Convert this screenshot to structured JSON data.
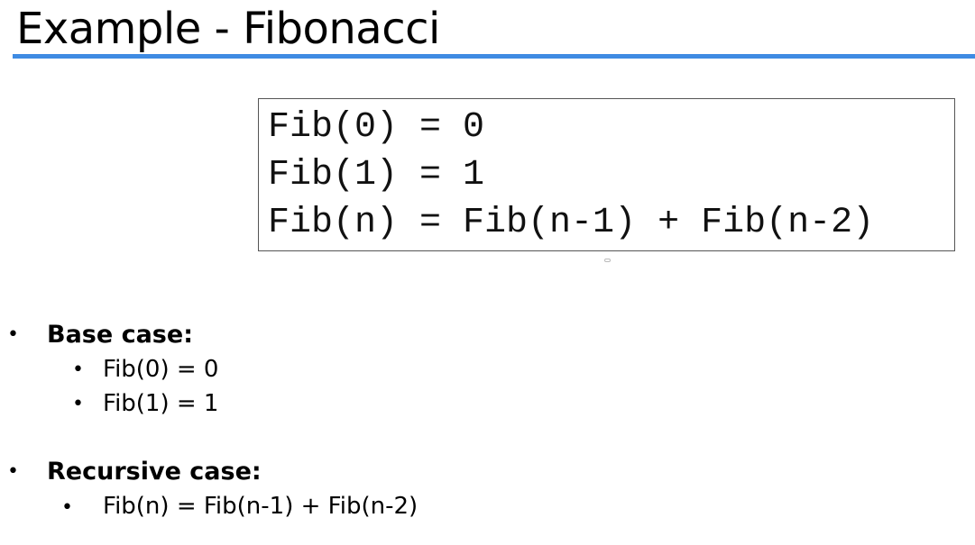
{
  "title": "Example - Fibonacci",
  "formula_lines": [
    "Fib(0) = 0",
    "Fib(1) = 1",
    "Fib(n) = Fib(n-1) + Fib(n-2)"
  ],
  "bullets": {
    "base_case": {
      "label": "Base case:",
      "items": [
        "Fib(0) = 0",
        "Fib(1) = 1"
      ]
    },
    "recursive_case": {
      "label": "Recursive case:",
      "items": [
        "Fib(n) = Fib(n-1) + Fib(n-2)"
      ]
    },
    "bullet_glyph": "•"
  },
  "colors": {
    "accent": "#3f8be3"
  }
}
